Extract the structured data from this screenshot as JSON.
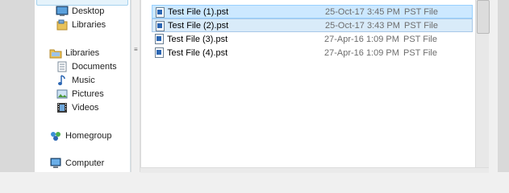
{
  "navigation": {
    "favorites": [
      {
        "label": "Desktop"
      },
      {
        "label": "Libraries"
      }
    ],
    "libraries": {
      "header": "Libraries",
      "items": [
        {
          "label": "Documents"
        },
        {
          "label": "Music"
        },
        {
          "label": "Pictures"
        },
        {
          "label": "Videos"
        }
      ]
    },
    "homegroup": "Homegroup",
    "computer": "Computer"
  },
  "files": [
    {
      "name": "Test File (1).pst",
      "date": "25-Oct-17 3:45 PM",
      "type": "PST File",
      "selected": true
    },
    {
      "name": "Test File (2).pst",
      "date": "25-Oct-17 3:43 PM",
      "type": "PST File",
      "selected": true
    },
    {
      "name": "Test File (3).pst",
      "date": "27-Apr-16 1:09 PM",
      "type": "PST File",
      "selected": false
    },
    {
      "name": "Test File (4).pst",
      "date": "27-Apr-16 1:09 PM",
      "type": "PST File",
      "selected": false
    }
  ],
  "splitter_glyph": "≡",
  "colors": {
    "selection_fill": "#cce8ff",
    "selection_border": "#99d1ff",
    "secondary_text": "#6d6d6d",
    "folder_yellow": "#e8c25a"
  }
}
